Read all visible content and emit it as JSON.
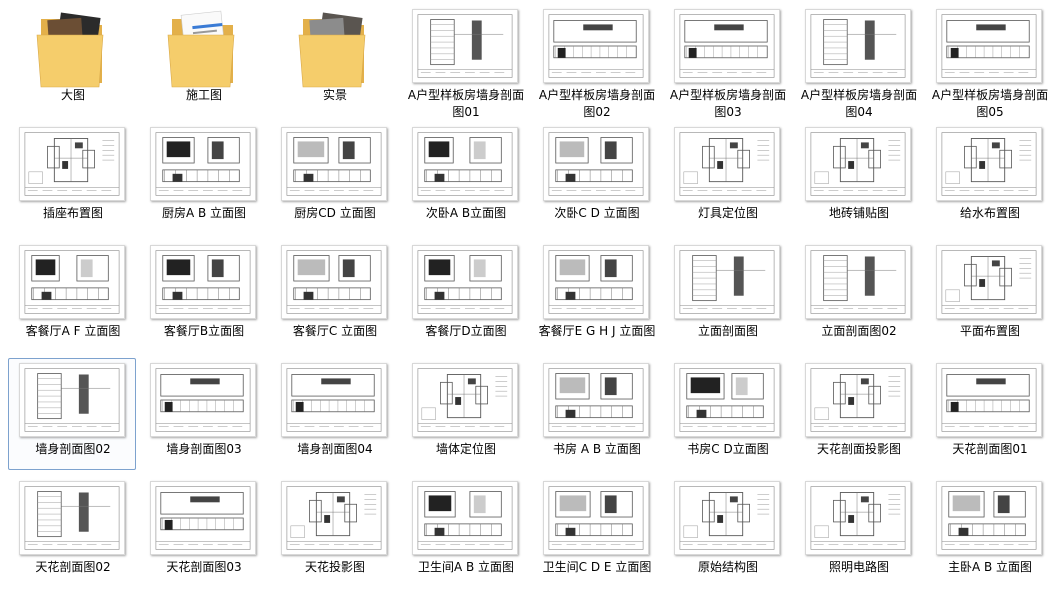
{
  "window": {
    "selected_index": 24
  },
  "items": [
    {
      "label": "大图",
      "type": "folder",
      "preview": "photo-dark"
    },
    {
      "label": "施工图",
      "type": "folder",
      "preview": "docs"
    },
    {
      "label": "实景",
      "type": "folder",
      "preview": "photo-room"
    },
    {
      "label": "A户型样板房墙身剖面图01",
      "type": "dwg",
      "pattern": "section"
    },
    {
      "label": "A户型样板房墙身剖面图02",
      "type": "dwg",
      "pattern": "section"
    },
    {
      "label": "A户型样板房墙身剖面图03",
      "type": "dwg",
      "pattern": "section"
    },
    {
      "label": "A户型样板房墙身剖面图04",
      "type": "dwg",
      "pattern": "section"
    },
    {
      "label": "A户型样板房墙身剖面图05",
      "type": "dwg",
      "pattern": "section"
    },
    {
      "label": "插座布置图",
      "type": "dwg",
      "pattern": "plan"
    },
    {
      "label": "厨房A B  立面图",
      "type": "dwg",
      "pattern": "elevation"
    },
    {
      "label": "厨房CD 立面图",
      "type": "dwg",
      "pattern": "elevation"
    },
    {
      "label": "次卧A B立面图",
      "type": "dwg",
      "pattern": "elevation"
    },
    {
      "label": "次卧C D 立面图",
      "type": "dwg",
      "pattern": "elevation"
    },
    {
      "label": "灯具定位图",
      "type": "dwg",
      "pattern": "plan"
    },
    {
      "label": "地砖铺贴图",
      "type": "dwg",
      "pattern": "plan"
    },
    {
      "label": "给水布置图",
      "type": "dwg",
      "pattern": "plan"
    },
    {
      "label": "客餐厅A F 立面图",
      "type": "dwg",
      "pattern": "elevation"
    },
    {
      "label": "客餐厅B立面图",
      "type": "dwg",
      "pattern": "elevation"
    },
    {
      "label": "客餐厅C 立面图",
      "type": "dwg",
      "pattern": "elevation"
    },
    {
      "label": "客餐厅D立面图",
      "type": "dwg",
      "pattern": "elevation"
    },
    {
      "label": "客餐厅E G H J 立面图",
      "type": "dwg",
      "pattern": "elevation"
    },
    {
      "label": "立面剖面图",
      "type": "dwg",
      "pattern": "section"
    },
    {
      "label": "立面剖面图02",
      "type": "dwg",
      "pattern": "section"
    },
    {
      "label": "平面布置图",
      "type": "dwg",
      "pattern": "plan"
    },
    {
      "label": "墙身剖面图02",
      "type": "dwg",
      "pattern": "section"
    },
    {
      "label": "墙身剖面图03",
      "type": "dwg",
      "pattern": "section"
    },
    {
      "label": "墙身剖面图04",
      "type": "dwg",
      "pattern": "section"
    },
    {
      "label": "墙体定位图",
      "type": "dwg",
      "pattern": "plan"
    },
    {
      "label": "书房 A B 立面图",
      "type": "dwg",
      "pattern": "elevation"
    },
    {
      "label": "书房C D立面图",
      "type": "dwg",
      "pattern": "elevation"
    },
    {
      "label": "天花剖面投影图",
      "type": "dwg",
      "pattern": "plan"
    },
    {
      "label": "天花剖面图01",
      "type": "dwg",
      "pattern": "section"
    },
    {
      "label": "天花剖面图02",
      "type": "dwg",
      "pattern": "section"
    },
    {
      "label": "天花剖面图03",
      "type": "dwg",
      "pattern": "section"
    },
    {
      "label": "天花投影图",
      "type": "dwg",
      "pattern": "plan"
    },
    {
      "label": "卫生间A B 立面图",
      "type": "dwg",
      "pattern": "elevation"
    },
    {
      "label": "卫生间C D E 立面图",
      "type": "dwg",
      "pattern": "elevation"
    },
    {
      "label": "原始结构图",
      "type": "dwg",
      "pattern": "plan"
    },
    {
      "label": "照明电路图",
      "type": "dwg",
      "pattern": "plan"
    },
    {
      "label": "主卧A B 立面图",
      "type": "dwg",
      "pattern": "elevation"
    }
  ],
  "colors": {
    "selection_border": "#7da2ce",
    "folder": "#f5cd6b",
    "folder_dark": "#e3b04a"
  }
}
